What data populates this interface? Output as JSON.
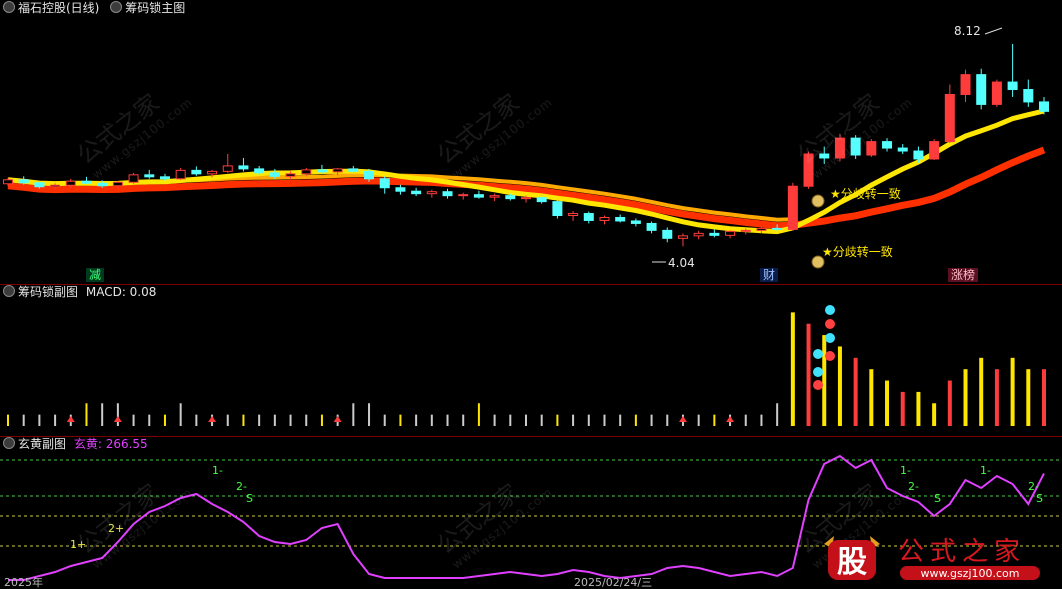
{
  "main_panel": {
    "title": "福石控股(日线)",
    "indicator": "筹码锁主图",
    "high_label": "8.12",
    "low_label": "4.04",
    "tags": {
      "reduce": "减",
      "finance": "财",
      "limit_list": "涨榜"
    },
    "annotations": [
      "★分歧转一致",
      "★分歧转一致"
    ]
  },
  "sub_panel_1": {
    "indicator": "筹码锁副图",
    "value_label": "MACD: 0.08"
  },
  "sub_panel_2": {
    "indicator": "玄黄副图",
    "value_label": "玄黄: 266.55",
    "level_labels": [
      "1+",
      "2+",
      "1-",
      "2-",
      "S",
      "1-",
      "2-",
      "S",
      "1-",
      "2-",
      "S"
    ]
  },
  "axis_labels": [
    "2025年",
    "2025/02/24/三"
  ],
  "watermark": {
    "text": "公式之家",
    "url": "www.gszj100.com"
  },
  "logo": {
    "badge": "股",
    "text": "公式之家",
    "url": "www.gszj100.com"
  },
  "colors": {
    "up": "#ff3c3c",
    "down": "#54ffff",
    "ma_yellow": "#ffe600",
    "ma_orange": "#ffaa00",
    "ma_red": "#ff3000",
    "ma_blue": "#1a2aff",
    "xuanhuang": "#e040ff",
    "tag_green": "#00c060",
    "tag_blue": "#3070ff",
    "tag_red": "#c03040"
  },
  "chart_data": [
    {
      "type": "candlestick",
      "title": "福石控股(日线)",
      "note": "price axis not printed; values in price units estimated from labels 8.12 and 4.04",
      "ohlc": [
        [
          5.3,
          5.42,
          5.25,
          5.38
        ],
        [
          5.38,
          5.45,
          5.28,
          5.32
        ],
        [
          5.32,
          5.36,
          5.2,
          5.24
        ],
        [
          5.24,
          5.31,
          5.18,
          5.27
        ],
        [
          5.27,
          5.4,
          5.22,
          5.35
        ],
        [
          5.35,
          5.44,
          5.3,
          5.31
        ],
        [
          5.31,
          5.37,
          5.22,
          5.26
        ],
        [
          5.26,
          5.35,
          5.2,
          5.33
        ],
        [
          5.33,
          5.52,
          5.3,
          5.48
        ],
        [
          5.48,
          5.58,
          5.4,
          5.44
        ],
        [
          5.44,
          5.5,
          5.36,
          5.4
        ],
        [
          5.4,
          5.62,
          5.38,
          5.57
        ],
        [
          5.57,
          5.65,
          5.46,
          5.5
        ],
        [
          5.5,
          5.58,
          5.43,
          5.55
        ],
        [
          5.55,
          5.9,
          5.52,
          5.66
        ],
        [
          5.66,
          5.82,
          5.55,
          5.6
        ],
        [
          5.6,
          5.66,
          5.47,
          5.52
        ],
        [
          5.52,
          5.6,
          5.4,
          5.45
        ],
        [
          5.45,
          5.55,
          5.38,
          5.5
        ],
        [
          5.5,
          5.62,
          5.45,
          5.58
        ],
        [
          5.58,
          5.68,
          5.5,
          5.54
        ],
        [
          5.54,
          5.62,
          5.47,
          5.6
        ],
        [
          5.6,
          5.66,
          5.52,
          5.55
        ],
        [
          5.55,
          5.6,
          5.34,
          5.4
        ],
        [
          5.4,
          5.45,
          5.1,
          5.22
        ],
        [
          5.22,
          5.28,
          5.08,
          5.15
        ],
        [
          5.15,
          5.22,
          5.05,
          5.1
        ],
        [
          5.1,
          5.18,
          5.02,
          5.14
        ],
        [
          5.14,
          5.2,
          5.0,
          5.06
        ],
        [
          5.06,
          5.12,
          4.98,
          5.08
        ],
        [
          5.08,
          5.16,
          5.0,
          5.03
        ],
        [
          5.03,
          5.1,
          4.95,
          5.06
        ],
        [
          5.06,
          5.1,
          4.96,
          5.0
        ],
        [
          5.0,
          5.06,
          4.92,
          5.02
        ],
        [
          5.02,
          5.08,
          4.9,
          4.94
        ],
        [
          4.94,
          4.98,
          4.6,
          4.66
        ],
        [
          4.66,
          4.75,
          4.55,
          4.7
        ],
        [
          4.7,
          4.74,
          4.5,
          4.56
        ],
        [
          4.56,
          4.66,
          4.48,
          4.62
        ],
        [
          4.62,
          4.68,
          4.52,
          4.55
        ],
        [
          4.55,
          4.6,
          4.44,
          4.5
        ],
        [
          4.5,
          4.54,
          4.3,
          4.36
        ],
        [
          4.36,
          4.42,
          4.12,
          4.2
        ],
        [
          4.2,
          4.3,
          4.04,
          4.25
        ],
        [
          4.25,
          4.35,
          4.18,
          4.3
        ],
        [
          4.3,
          4.38,
          4.22,
          4.26
        ],
        [
          4.26,
          4.36,
          4.2,
          4.34
        ],
        [
          4.34,
          4.4,
          4.28,
          4.36
        ],
        [
          4.36,
          4.44,
          4.3,
          4.4
        ],
        [
          4.4,
          4.48,
          4.34,
          4.38
        ],
        [
          4.38,
          5.32,
          4.36,
          5.25
        ],
        [
          5.25,
          5.95,
          5.2,
          5.9
        ],
        [
          5.9,
          6.05,
          5.7,
          5.82
        ],
        [
          5.82,
          6.3,
          5.75,
          6.22
        ],
        [
          6.22,
          6.28,
          5.8,
          5.88
        ],
        [
          5.88,
          6.2,
          5.84,
          6.15
        ],
        [
          6.15,
          6.22,
          5.95,
          6.02
        ],
        [
          6.02,
          6.1,
          5.9,
          5.96
        ],
        [
          5.96,
          6.05,
          5.72,
          5.8
        ],
        [
          5.8,
          6.2,
          5.78,
          6.15
        ],
        [
          6.15,
          7.3,
          6.12,
          7.1
        ],
        [
          7.1,
          7.6,
          6.95,
          7.5
        ],
        [
          7.5,
          7.62,
          6.8,
          6.9
        ],
        [
          6.9,
          7.4,
          6.85,
          7.35
        ],
        [
          7.35,
          8.12,
          7.05,
          7.2
        ],
        [
          7.2,
          7.4,
          6.85,
          6.95
        ],
        [
          6.95,
          7.05,
          6.7,
          6.76
        ]
      ]
    },
    {
      "type": "bar",
      "title": "筹码锁副图",
      "ylabel": "MACD",
      "values": [
        0.01,
        0.01,
        0.01,
        0.01,
        0.01,
        0.02,
        0.02,
        0.02,
        0.01,
        0.01,
        0.01,
        0.02,
        0.01,
        0.01,
        0.01,
        0.01,
        0.01,
        0.01,
        0.01,
        0.01,
        0.01,
        0.01,
        0.02,
        0.02,
        0.01,
        0.01,
        0.01,
        0.01,
        0.01,
        0.01,
        0.02,
        0.01,
        0.01,
        0.01,
        0.01,
        0.01,
        0.01,
        0.01,
        0.01,
        0.01,
        0.01,
        0.01,
        0.01,
        0.01,
        0.01,
        0.01,
        0.01,
        0.01,
        0.01,
        0.02,
        0.1,
        0.09,
        0.08,
        0.07,
        0.06,
        0.05,
        0.04,
        0.03,
        0.03,
        0.02,
        0.04,
        0.05,
        0.06,
        0.05,
        0.06,
        0.05,
        0.05
      ]
    },
    {
      "type": "line",
      "title": "玄黄副图",
      "series": [
        {
          "name": "玄黄",
          "values": [
            0,
            0,
            10,
            20,
            35,
            45,
            55,
            95,
            140,
            170,
            185,
            205,
            215,
            190,
            170,
            145,
            110,
            95,
            90,
            100,
            130,
            140,
            65,
            15,
            5,
            5,
            5,
            5,
            5,
            5,
            10,
            15,
            20,
            15,
            10,
            15,
            25,
            20,
            10,
            5,
            10,
            15,
            30,
            35,
            30,
            20,
            10,
            15,
            20,
            10,
            30,
            200,
            290,
            310,
            280,
            300,
            230,
            210,
            195,
            160,
            190,
            250,
            230,
            260,
            240,
            190,
            266.55
          ]
        }
      ],
      "ylim": [
        0,
        320
      ]
    }
  ]
}
